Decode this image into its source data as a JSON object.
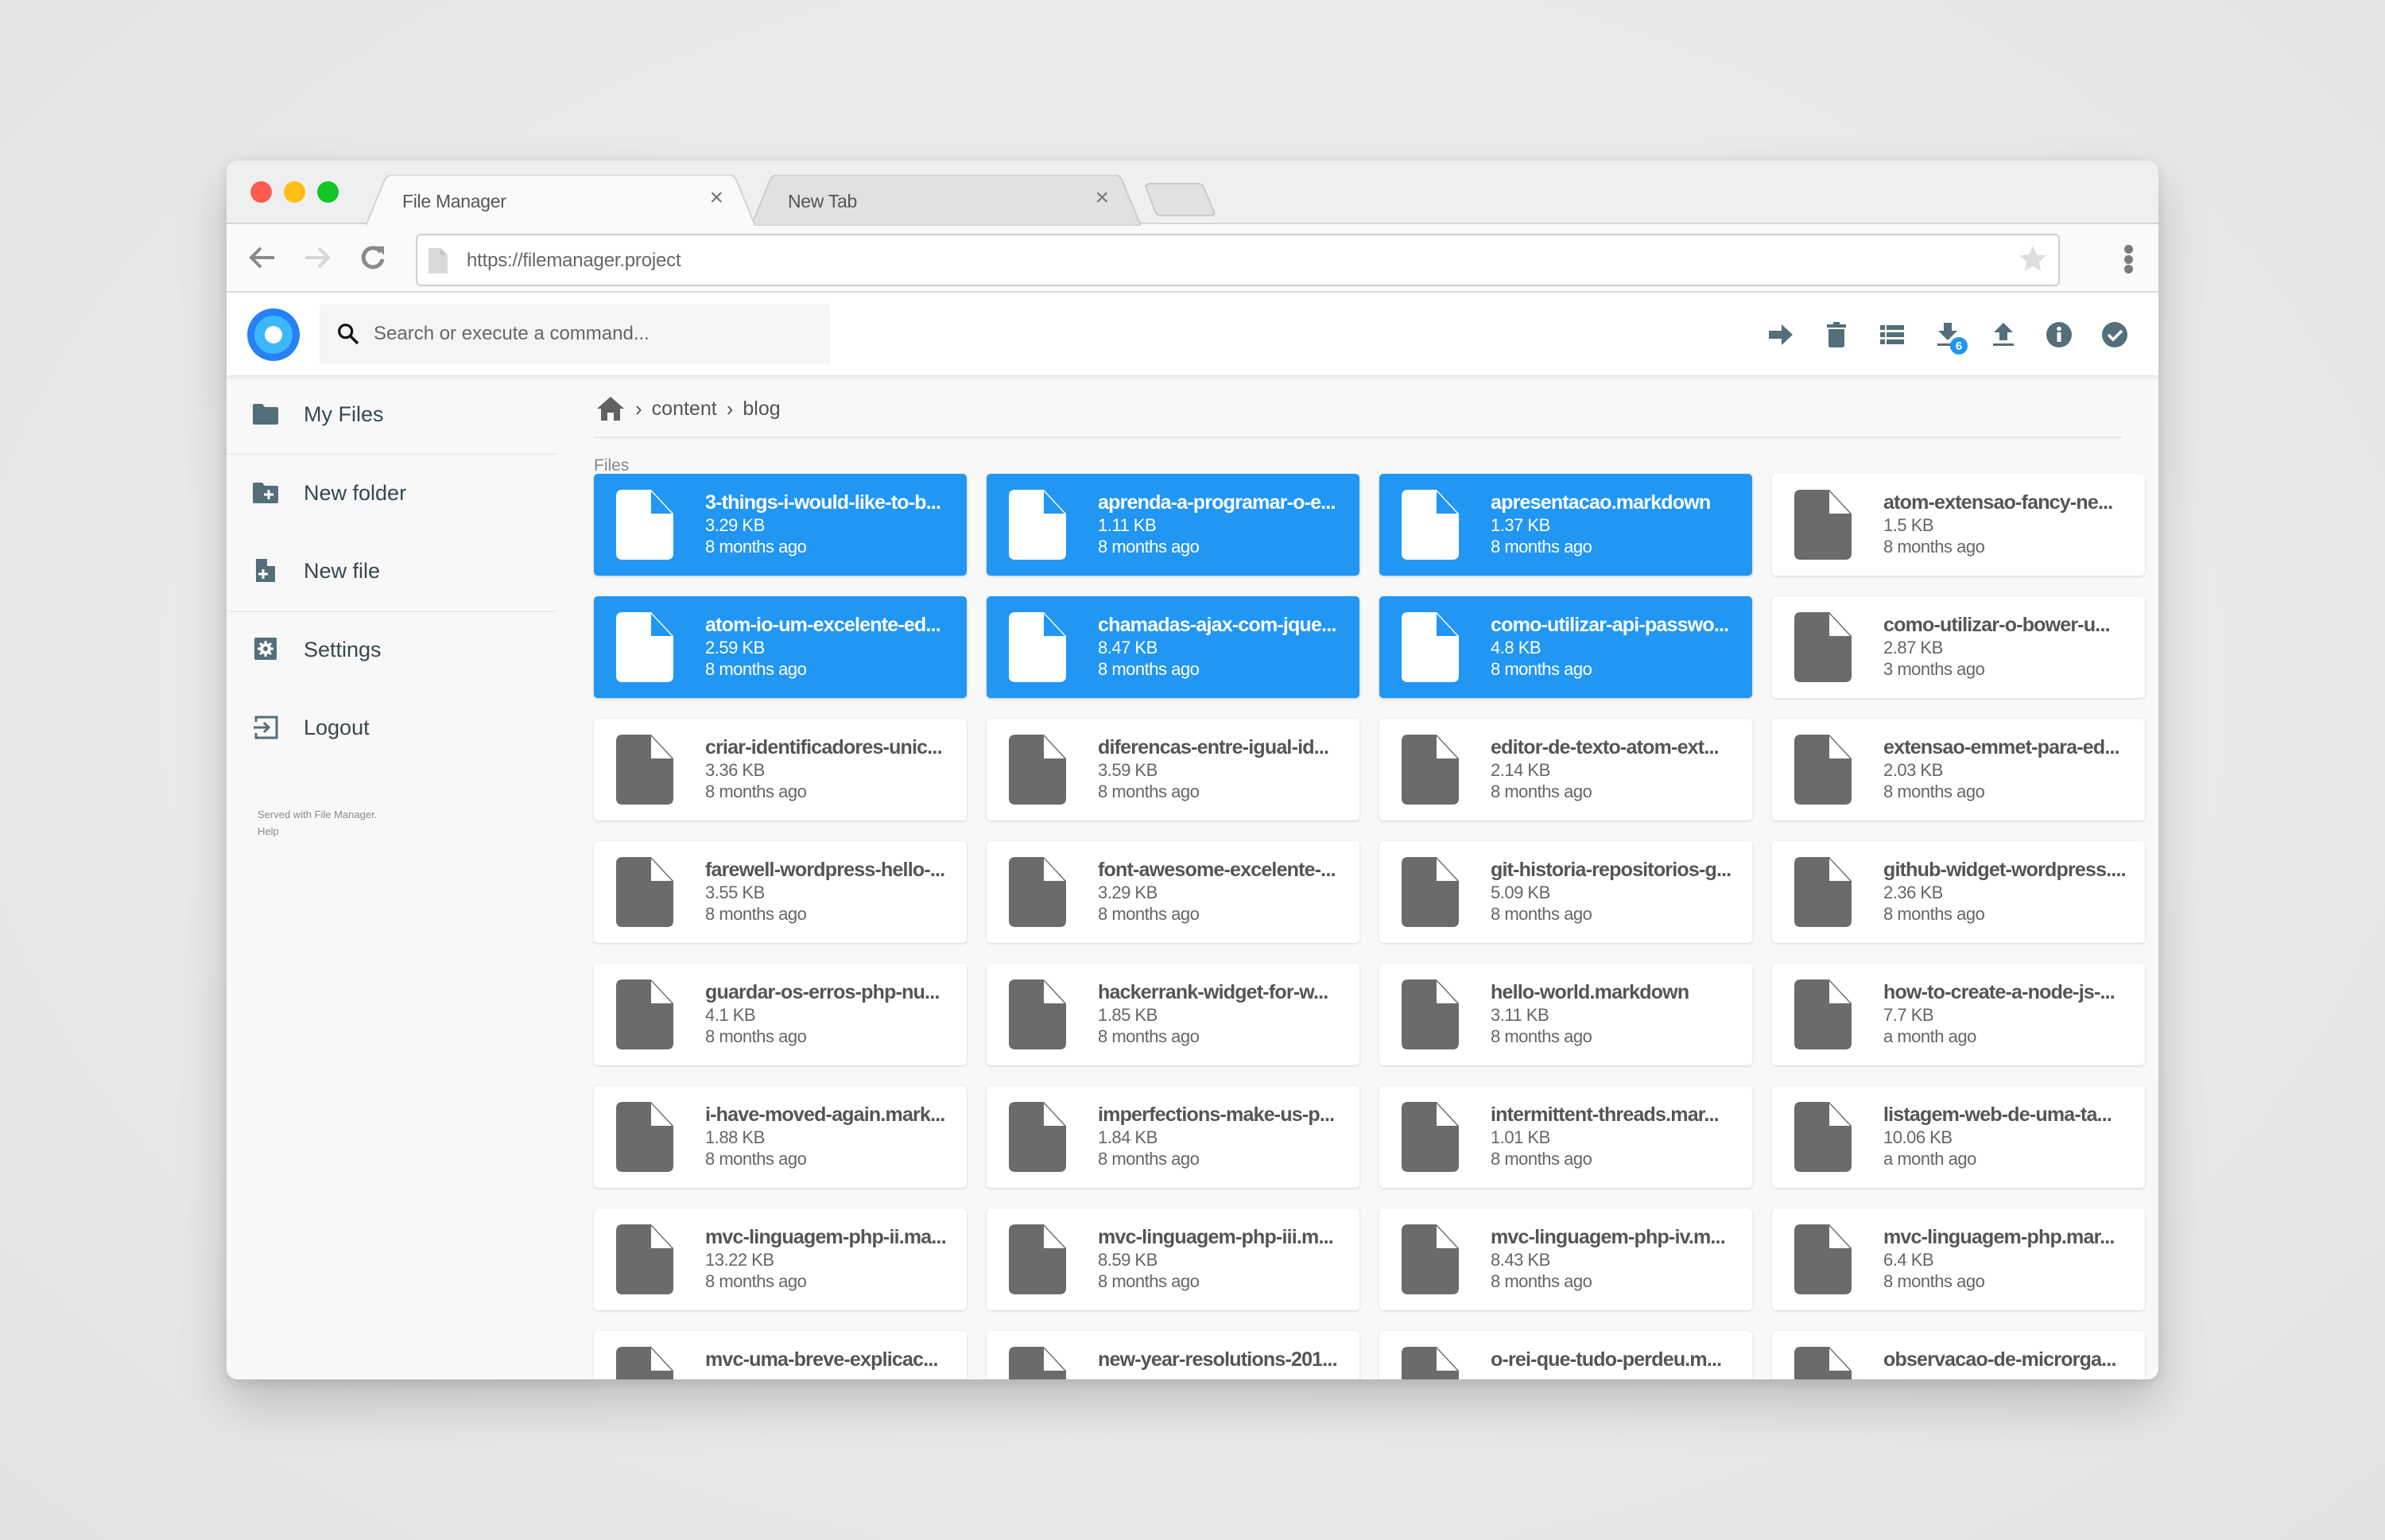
{
  "browser": {
    "tabs": [
      {
        "label": "File Manager",
        "active": true
      },
      {
        "label": "New Tab",
        "active": false
      }
    ],
    "close_glyph": "×",
    "url": "https://filemanager.project",
    "icons": [
      "back-arrow-icon",
      "forward-arrow-icon",
      "reload-icon",
      "page-icon",
      "bookmark-star-icon",
      "menu-dots-icon"
    ]
  },
  "header": {
    "search_placeholder": "Search or execute a command...",
    "actions": [
      {
        "name": "move",
        "icon": "arrow-right-icon"
      },
      {
        "name": "delete",
        "icon": "trash-icon"
      },
      {
        "name": "switch-view",
        "icon": "list-view-icon"
      },
      {
        "name": "download",
        "icon": "download-icon",
        "badge": "6"
      },
      {
        "name": "upload",
        "icon": "upload-icon"
      },
      {
        "name": "info",
        "icon": "info-icon"
      },
      {
        "name": "select",
        "icon": "check-circle-icon"
      }
    ],
    "accent_color": "#2196f3"
  },
  "sidebar": {
    "items": [
      {
        "label": "My Files",
        "icon": "folder-icon"
      },
      {
        "label": "New folder",
        "icon": "new-folder-icon"
      },
      {
        "label": "New file",
        "icon": "new-file-icon"
      },
      {
        "label": "Settings",
        "icon": "settings-icon"
      },
      {
        "label": "Logout",
        "icon": "logout-icon"
      }
    ],
    "credits": "Served with File Manager.",
    "help": "Help"
  },
  "breadcrumb": {
    "home_icon": "home-icon",
    "separator": "›",
    "items": [
      "content",
      "blog"
    ]
  },
  "files": {
    "section_label": "Files",
    "items": [
      {
        "name": "3-things-i-would-like-to-b...",
        "size": "3.29 KB",
        "modified": "8 months ago",
        "selected": true
      },
      {
        "name": "aprenda-a-programar-o-e...",
        "size": "1.11 KB",
        "modified": "8 months ago",
        "selected": true
      },
      {
        "name": "apresentacao.markdown",
        "size": "1.37 KB",
        "modified": "8 months ago",
        "selected": true
      },
      {
        "name": "atom-extensao-fancy-ne...",
        "size": "1.5 KB",
        "modified": "8 months ago",
        "selected": false
      },
      {
        "name": "atom-io-um-excelente-ed...",
        "size": "2.59 KB",
        "modified": "8 months ago",
        "selected": true
      },
      {
        "name": "chamadas-ajax-com-jque...",
        "size": "8.47 KB",
        "modified": "8 months ago",
        "selected": true
      },
      {
        "name": "como-utilizar-api-passwo...",
        "size": "4.8 KB",
        "modified": "8 months ago",
        "selected": true
      },
      {
        "name": "como-utilizar-o-bower-u...",
        "size": "2.87 KB",
        "modified": "3 months ago",
        "selected": false
      },
      {
        "name": "criar-identificadores-unic...",
        "size": "3.36 KB",
        "modified": "8 months ago",
        "selected": false
      },
      {
        "name": "diferencas-entre-igual-id...",
        "size": "3.59 KB",
        "modified": "8 months ago",
        "selected": false
      },
      {
        "name": "editor-de-texto-atom-ext...",
        "size": "2.14 KB",
        "modified": "8 months ago",
        "selected": false
      },
      {
        "name": "extensao-emmet-para-ed...",
        "size": "2.03 KB",
        "modified": "8 months ago",
        "selected": false
      },
      {
        "name": "farewell-wordpress-hello-...",
        "size": "3.55 KB",
        "modified": "8 months ago",
        "selected": false
      },
      {
        "name": "font-awesome-excelente-...",
        "size": "3.29 KB",
        "modified": "8 months ago",
        "selected": false
      },
      {
        "name": "git-historia-repositorios-g...",
        "size": "5.09 KB",
        "modified": "8 months ago",
        "selected": false
      },
      {
        "name": "github-widget-wordpress....",
        "size": "2.36 KB",
        "modified": "8 months ago",
        "selected": false
      },
      {
        "name": "guardar-os-erros-php-nu...",
        "size": "4.1 KB",
        "modified": "8 months ago",
        "selected": false
      },
      {
        "name": "hackerrank-widget-for-w...",
        "size": "1.85 KB",
        "modified": "8 months ago",
        "selected": false
      },
      {
        "name": "hello-world.markdown",
        "size": "3.11 KB",
        "modified": "8 months ago",
        "selected": false
      },
      {
        "name": "how-to-create-a-node-js-...",
        "size": "7.7 KB",
        "modified": "a month ago",
        "selected": false
      },
      {
        "name": "i-have-moved-again.mark...",
        "size": "1.88 KB",
        "modified": "8 months ago",
        "selected": false
      },
      {
        "name": "imperfections-make-us-p...",
        "size": "1.84 KB",
        "modified": "8 months ago",
        "selected": false
      },
      {
        "name": "intermittent-threads.mar...",
        "size": "1.01 KB",
        "modified": "8 months ago",
        "selected": false
      },
      {
        "name": "listagem-web-de-uma-ta...",
        "size": "10.06 KB",
        "modified": "a month ago",
        "selected": false
      },
      {
        "name": "mvc-linguagem-php-ii.ma...",
        "size": "13.22 KB",
        "modified": "8 months ago",
        "selected": false
      },
      {
        "name": "mvc-linguagem-php-iii.m...",
        "size": "8.59 KB",
        "modified": "8 months ago",
        "selected": false
      },
      {
        "name": "mvc-linguagem-php-iv.m...",
        "size": "8.43 KB",
        "modified": "8 months ago",
        "selected": false
      },
      {
        "name": "mvc-linguagem-php.mar...",
        "size": "6.4 KB",
        "modified": "8 months ago",
        "selected": false
      },
      {
        "name": "mvc-uma-breve-explicac...",
        "size": "",
        "modified": "",
        "selected": false
      },
      {
        "name": "new-year-resolutions-201...",
        "size": "",
        "modified": "",
        "selected": false
      },
      {
        "name": "o-rei-que-tudo-perdeu.m...",
        "size": "",
        "modified": "",
        "selected": false
      },
      {
        "name": "observacao-de-microrga...",
        "size": "",
        "modified": "",
        "selected": false
      }
    ]
  }
}
